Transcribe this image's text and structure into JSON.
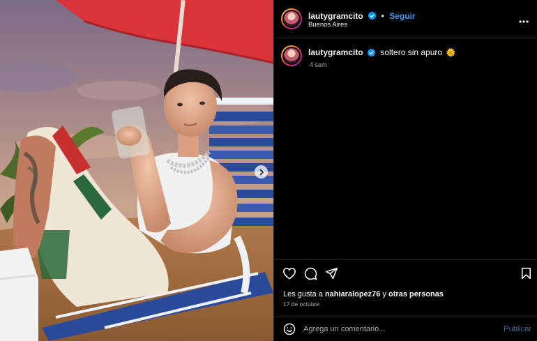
{
  "post": {
    "username": "lautygramcito",
    "follow_label": "Seguir",
    "location": "Buenos Aires",
    "more_icon": "more-horizontal-icon",
    "caption": {
      "username": "lautygramcito",
      "text": "soltero sin apuro",
      "emoji": "🌞"
    },
    "time_ago": "4 sem",
    "likes": {
      "prefix": "Les gusta a ",
      "user": "nahiaralopez76",
      "middle": " y ",
      "others": "otras personas"
    },
    "date": "17 de octubre"
  },
  "actions": {
    "like_icon": "heart-icon",
    "comment_icon": "comment-icon",
    "share_icon": "share-icon",
    "save_icon": "bookmark-icon"
  },
  "comment_box": {
    "placeholder": "Agrega un comentario...",
    "publish_label": "Publicar",
    "emoji_icon": "emoji-icon"
  },
  "colors": {
    "background": "#000000",
    "accent": "#3797f0",
    "verified": "#0095f6",
    "muted": "#a8a8a8",
    "divider": "#262626"
  }
}
